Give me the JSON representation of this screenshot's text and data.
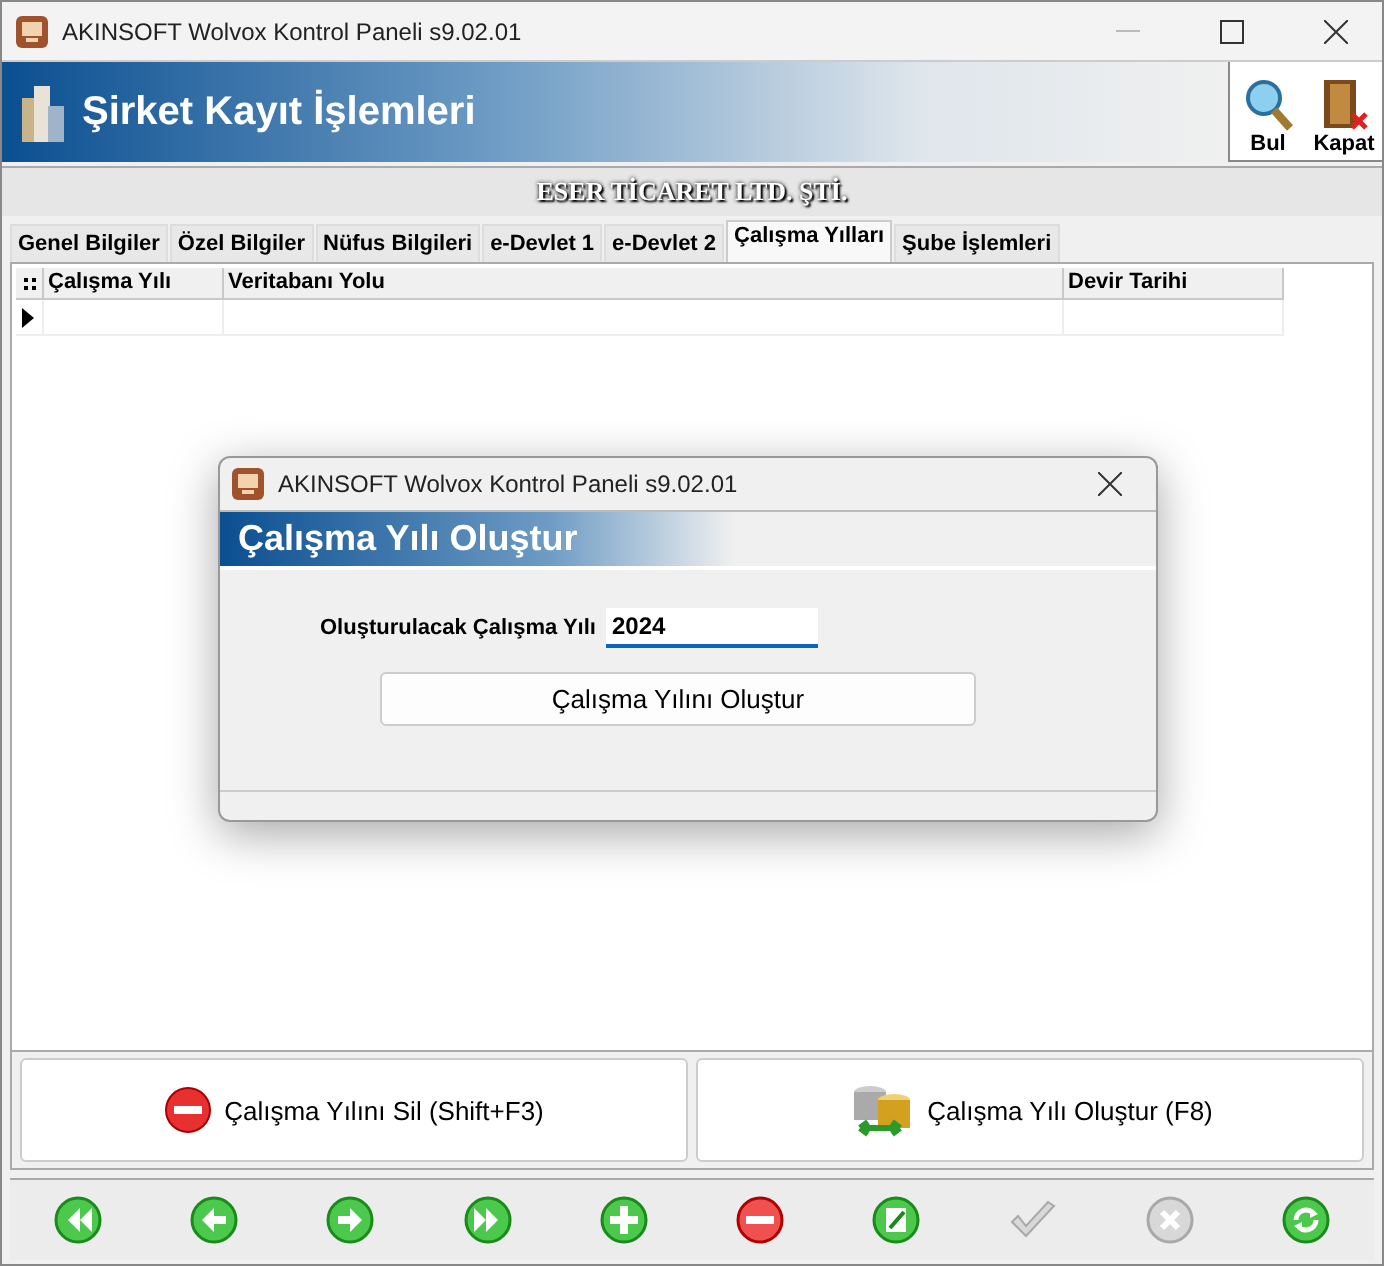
{
  "window": {
    "title": "AKINSOFT Wolvox Kontrol Paneli s9.02.01"
  },
  "header": {
    "title": "Şirket Kayıt İşlemleri"
  },
  "toolbar": [
    {
      "kind": "search",
      "label": "Bul"
    },
    {
      "kind": "close",
      "label": "Kapat"
    }
  ],
  "company": "ESER TİCARET LTD. ŞTİ.",
  "tabs": [
    {
      "label": "Genel Bilgiler",
      "selected": false
    },
    {
      "label": "Özel Bilgiler",
      "selected": false
    },
    {
      "label": "Nüfus Bilgileri",
      "selected": false
    },
    {
      "label": "e-Devlet 1",
      "selected": false
    },
    {
      "label": "e-Devlet 2",
      "selected": false
    },
    {
      "label": "Çalışma Yılları",
      "selected": true
    },
    {
      "label": "Şube İşlemleri",
      "selected": false
    }
  ],
  "table": {
    "columns": [
      "Çalışma Yılı",
      "Veritabanı Yolu",
      "Devir Tarihi"
    ]
  },
  "actions": [
    {
      "kind": "delete",
      "label": "Çalışma Yılını Sil (Shift+F3)"
    },
    {
      "kind": "create",
      "label": "Çalışma Yılı Oluştur (F8)"
    }
  ],
  "nav_buttons": [
    {
      "kind": "first",
      "disabled": false
    },
    {
      "kind": "prev",
      "disabled": false
    },
    {
      "kind": "next",
      "disabled": false
    },
    {
      "kind": "last",
      "disabled": false
    },
    {
      "kind": "add",
      "disabled": false
    },
    {
      "kind": "remove",
      "disabled": false
    },
    {
      "kind": "edit",
      "disabled": false
    },
    {
      "kind": "save",
      "disabled": true
    },
    {
      "kind": "cancel",
      "disabled": true
    },
    {
      "kind": "refresh",
      "disabled": false
    }
  ],
  "dialog": {
    "title": "AKINSOFT Wolvox Kontrol Paneli s9.02.01",
    "header": "Çalışma Yılı Oluştur",
    "field_label": "Oluşturulacak Çalışma Yılı",
    "field_value": "2024",
    "button": "Çalışma Yılını Oluştur"
  }
}
